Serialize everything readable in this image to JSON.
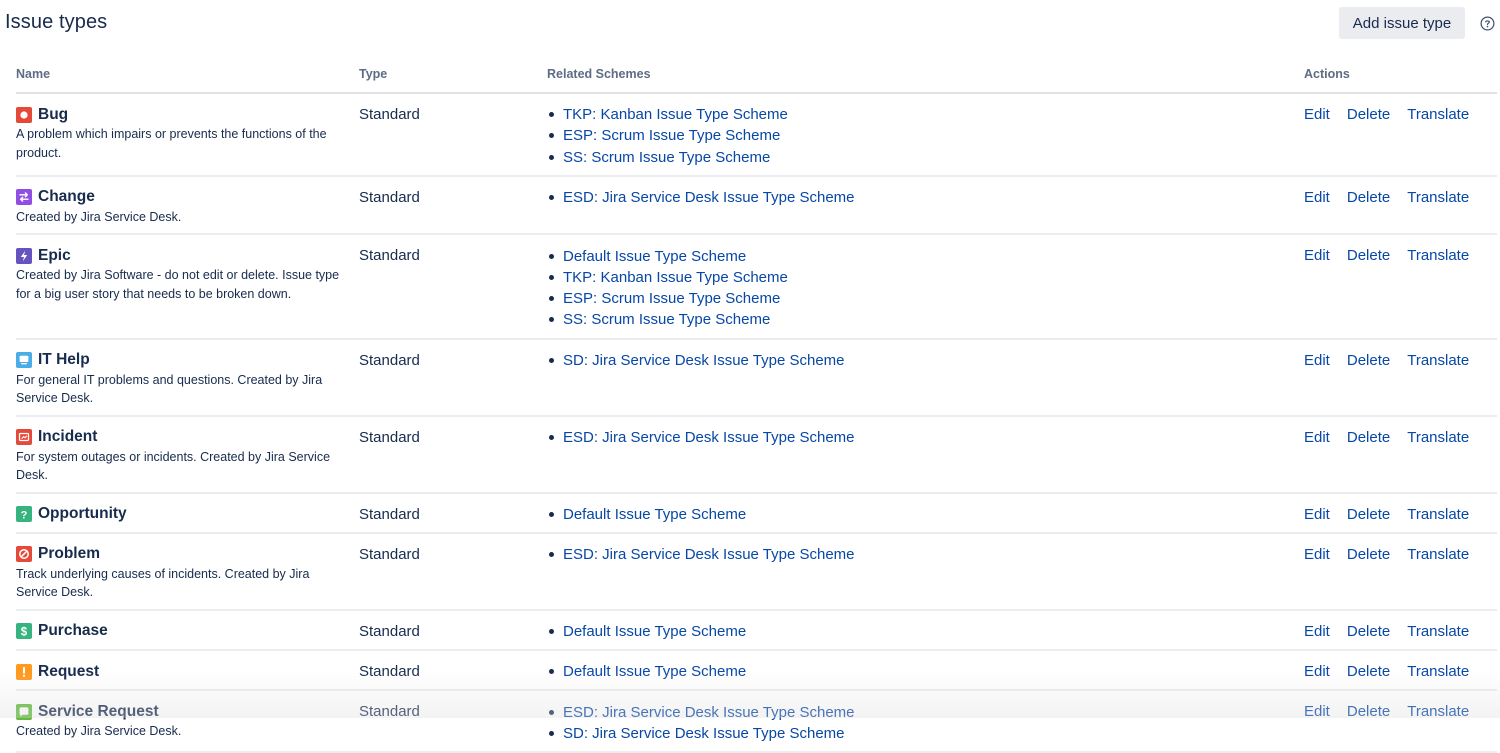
{
  "header": {
    "title": "Issue types",
    "add_button_label": "Add issue type",
    "help_icon": "question-circle-icon"
  },
  "table": {
    "columns": {
      "name": "Name",
      "type": "Type",
      "schemes": "Related Schemes",
      "actions": "Actions"
    },
    "action_labels": {
      "edit": "Edit",
      "delete": "Delete",
      "translate": "Translate"
    },
    "rows": [
      {
        "name": "Bug",
        "icon": "bug-icon",
        "icon_color": "#e5493a",
        "description": "A problem which impairs or prevents the functions of the product.",
        "type": "Standard",
        "schemes": [
          "TKP: Kanban Issue Type Scheme",
          "ESP: Scrum Issue Type Scheme",
          "SS: Scrum Issue Type Scheme"
        ]
      },
      {
        "name": "Change",
        "icon": "change-icon",
        "icon_color": "#904ee2",
        "description": "Created by Jira Service Desk.",
        "type": "Standard",
        "schemes": [
          "ESD: Jira Service Desk Issue Type Scheme"
        ]
      },
      {
        "name": "Epic",
        "icon": "epic-icon",
        "icon_color": "#6554c0",
        "description": "Created by Jira Software - do not edit or delete. Issue type for a big user story that needs to be broken down.",
        "type": "Standard",
        "schemes": [
          "Default Issue Type Scheme",
          "TKP: Kanban Issue Type Scheme",
          "ESP: Scrum Issue Type Scheme",
          "SS: Scrum Issue Type Scheme"
        ]
      },
      {
        "name": "IT Help",
        "icon": "it-help-icon",
        "icon_color": "#4bade8",
        "description": "For general IT problems and questions. Created by Jira Service Desk.",
        "type": "Standard",
        "schemes": [
          "SD: Jira Service Desk Issue Type Scheme"
        ]
      },
      {
        "name": "Incident",
        "icon": "incident-icon",
        "icon_color": "#e5493a",
        "description": "For system outages or incidents. Created by Jira Service Desk.",
        "type": "Standard",
        "schemes": [
          "ESD: Jira Service Desk Issue Type Scheme"
        ]
      },
      {
        "name": "Opportunity",
        "icon": "opportunity-icon",
        "icon_color": "#36b37e",
        "description": "",
        "type": "Standard",
        "schemes": [
          "Default Issue Type Scheme"
        ]
      },
      {
        "name": "Problem",
        "icon": "problem-icon",
        "icon_color": "#e5493a",
        "description": "Track underlying causes of incidents. Created by Jira Service Desk.",
        "type": "Standard",
        "schemes": [
          "ESD: Jira Service Desk Issue Type Scheme"
        ]
      },
      {
        "name": "Purchase",
        "icon": "purchase-icon",
        "icon_color": "#36b37e",
        "description": "",
        "type": "Standard",
        "schemes": [
          "Default Issue Type Scheme"
        ]
      },
      {
        "name": "Request",
        "icon": "request-icon",
        "icon_color": "#ff991f",
        "description": "",
        "type": "Standard",
        "schemes": [
          "Default Issue Type Scheme"
        ]
      },
      {
        "name": "Service Request",
        "icon": "service-request-icon",
        "icon_color": "#63ba3c",
        "description": "Created by Jira Service Desk.",
        "type": "Standard",
        "schemes": [
          "ESD: Jira Service Desk Issue Type Scheme",
          "SD: Jira Service Desk Issue Type Scheme"
        ]
      }
    ]
  }
}
